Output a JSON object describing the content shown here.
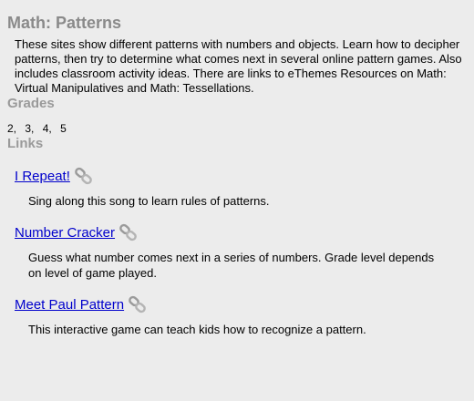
{
  "page": {
    "title": "Math: Patterns",
    "description": "These sites show different patterns with numbers and objects. Learn how to decipher patterns, then try to determine what comes next in several online pattern games. Also includes classroom activity ideas. There are links to eThemes Resources on Math: Virtual Manipulatives and Math: Tessellations."
  },
  "grades": {
    "heading": "Grades",
    "values": [
      "2,",
      "3,",
      "4,",
      "5"
    ]
  },
  "links": {
    "heading": "Links",
    "items": [
      {
        "label": "I Repeat!",
        "description": "Sing along this song to learn rules of patterns.",
        "icon": "chain-link-icon"
      },
      {
        "label": "Number Cracker",
        "description": "Guess what number comes next in a series of numbers. Grade level depends on level of game played.",
        "icon": "chain-link-icon"
      },
      {
        "label": "Meet Paul Pattern",
        "description": "This interactive game can teach kids how to recognize a pattern.",
        "icon": "chain-link-icon"
      }
    ]
  },
  "colors": {
    "background": "#ececec",
    "heading": "#8a8a8a",
    "link": "#0000cc"
  }
}
